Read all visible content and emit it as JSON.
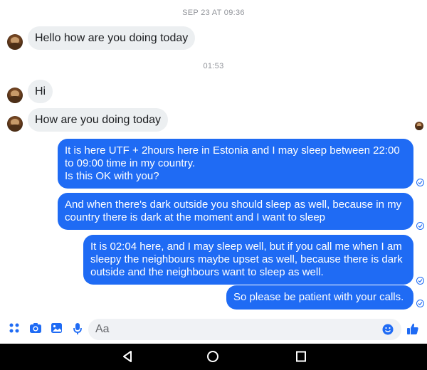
{
  "thread": {
    "timestamps": [
      "SEP 23 AT 09:36",
      "01:53"
    ],
    "incoming": [
      "Hello how are you doing today",
      "Hi",
      "How are you doing today"
    ],
    "outgoing": [
      {
        "lines": [
          "It is here UTF + 2hours here in Estonia and I may sleep between 22:00",
          "to 09:00 time in my country.",
          "Is this OK with you?"
        ]
      },
      {
        "lines": [
          "And when there's dark outside you should sleep as well, because in my",
          "country there is dark at the moment and I want to sleep"
        ]
      },
      {
        "lines": [
          "It is 02:04 here, and I may sleep well, but if you call me when I am",
          "sleepy the neighbours maybe upset as well, because there is dark",
          "outside and the neighbours want to sleep as well."
        ]
      },
      {
        "lines": [
          "So please be patient with your calls."
        ]
      }
    ]
  },
  "composer": {
    "placeholder": "Aa",
    "icons": [
      "more-icon",
      "camera-icon",
      "gallery-icon",
      "microphone-icon",
      "emoji-icon",
      "like-icon"
    ]
  },
  "navigation": {
    "icons": [
      "back-icon",
      "home-icon",
      "recents-icon"
    ]
  },
  "colors": {
    "accent": "#1f6bf4",
    "incoming_bubble": "#eceff1",
    "navbar": "#000000"
  }
}
